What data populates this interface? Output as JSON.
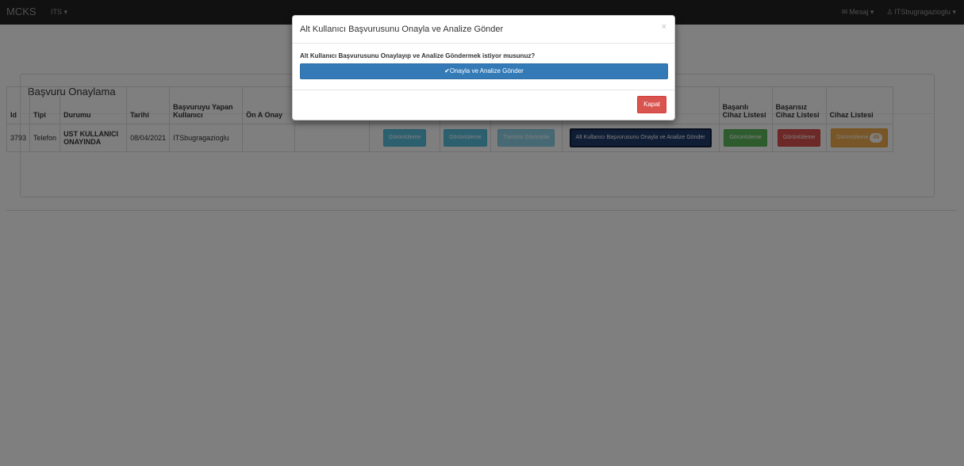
{
  "navbar": {
    "brand": "MCKS",
    "its_menu": "ITS ▾",
    "mesaj": "Mesaj ▾",
    "user": "ITSbugragazioglu ▾"
  },
  "panel": {
    "title": "Başvuru Onaylama"
  },
  "table": {
    "headers": {
      "id": "Id",
      "tipi": "Tipi",
      "durumu": "Durumu",
      "tarihi": "Tarihi",
      "yapan": "Başvuruyu Yapan Kullanıcı",
      "on_onay": "Ön A Onay",
      "basarili": "Başarılı Cihaz Listesi",
      "basarisiz": "Başarısız Cihaz Listesi",
      "cihaz": "Cihaz Listesi"
    },
    "row": {
      "id": "3793",
      "tipi": "Telefon",
      "durumu": "UST KULLANICI ONAYINDA",
      "tarihi": "08/04/2021",
      "kullanici": "ITSbugragazioglu",
      "btn1": "Görüntüleme",
      "btn2": "Görüntüleme",
      "btn3": "Tümünü Görüntüle",
      "btn_onayla": "Alt Kullanıcı Başvurusunu Onayla ve Analize Gönder",
      "btn_basarili": "Görüntüleme",
      "btn_basarisiz": "Görüntüleme",
      "btn_cihaz": "Görüntüleme",
      "cihaz_badge": "45"
    }
  },
  "modal": {
    "title": "Alt Kullanıcı Başvurusunu Onayla ve Analize Gönder",
    "close": "×",
    "question": "Alt Kullanıcı Başvurusunu Onaylayıp ve Analize Göndermek istiyor musunuz?",
    "confirm_label": "✔Onayla ve Analize Gönder",
    "kapat_label": "Kapat"
  }
}
